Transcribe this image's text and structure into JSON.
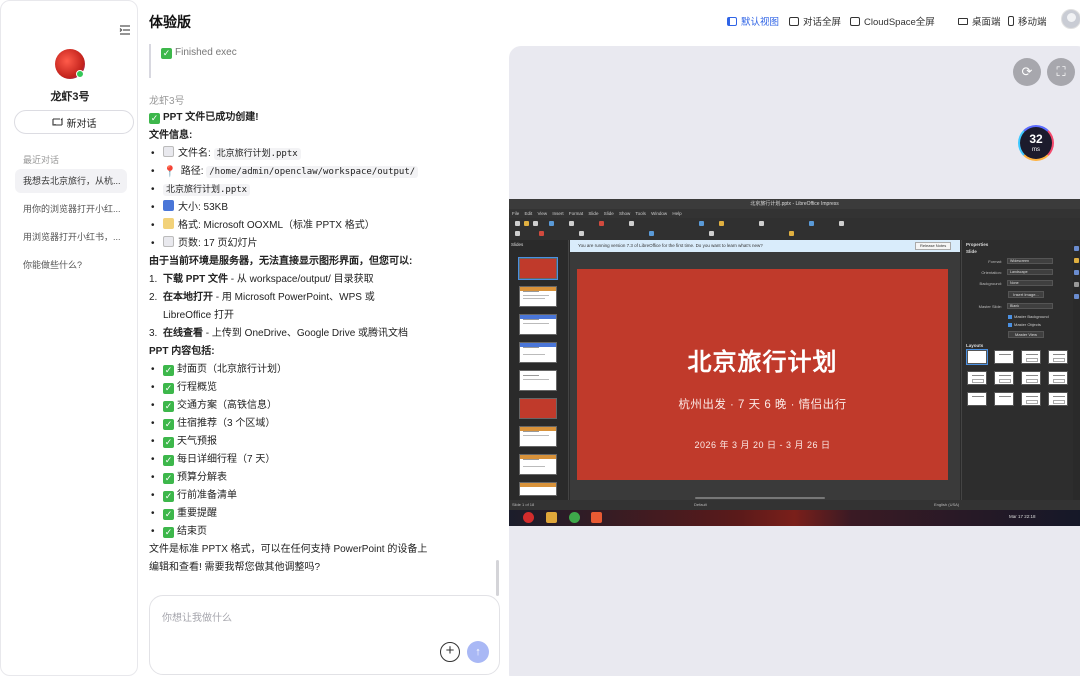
{
  "app": {
    "title": "体验版"
  },
  "sidebar": {
    "bot_name": "龙虾3号",
    "new_chat": "新对话",
    "recent_label": "最近对话",
    "conversations": [
      "我想去北京旅行，从杭...",
      "用你的浏览器打开小红...",
      "用浏览器打开小红书，...",
      "你能做些什么?"
    ]
  },
  "header": {
    "view_default": "默认视图",
    "view_chat_full": "对话全屏",
    "view_cloudspace_full": "CloudSpace全屏",
    "desktop": "桌面端",
    "mobile": "移动端",
    "accent": "#2f64e6"
  },
  "chat": {
    "exec_status": "Finished exec",
    "sender": "龙虾3号",
    "headline": "PPT 文件已成功创建!",
    "file_info_title": "文件信息:",
    "file_name_label": "文件名:",
    "file_name": "北京旅行计划.pptx",
    "path_label": "路径:",
    "path_part1": "/home/admin/openclaw/workspace/output/",
    "path_part2": "北京旅行计划.pptx",
    "size": "大小: 53KB",
    "format": "格式: Microsoft OOXML（标准 PPTX 格式）",
    "pages": "页数: 17 页幻灯片",
    "server_note": "由于当前环境是服务器，无法直接显示图形界面，但您可以:",
    "options": [
      {
        "num": "1.",
        "bold": "下载 PPT 文件",
        "rest": " - 从 workspace/output/ 目录获取"
      },
      {
        "num": "2.",
        "bold": "在本地打开",
        "rest": " - 用 Microsoft PowerPoint、WPS 或",
        "cont": "LibreOffice 打开"
      },
      {
        "num": "3.",
        "bold": "在线查看",
        "rest": " - 上传到 OneDrive、Google Drive 或腾讯文档"
      }
    ],
    "contents_title": "PPT 内容包括:",
    "contents": [
      "封面页（北京旅行计划）",
      "行程概览",
      "交通方案（高铁信息）",
      "住宿推荐（3 个区域）",
      "天气预报",
      "每日详细行程（7 天）",
      "预算分解表",
      "行前准备清单",
      "重要提醒",
      "结束页"
    ],
    "closing_line1": "文件是标准 PPTX 格式，可以在任何支持 PowerPoint 的设备上",
    "closing_line2": "编辑和查看! 需要我帮您做其他调整吗?"
  },
  "input": {
    "placeholder": "你想让我做什么"
  },
  "panel": {
    "latency_value": "32",
    "latency_unit": "ms"
  },
  "desktop_screen": {
    "window_title": "北京旅行计划.pptx - LibreOffice Impress",
    "menu": "File Edit View Insert Format Slide Slide Show Tools Window Help",
    "slides_label": "Slides",
    "info_text": "You are running version 7.3 of LibreOffice for the first time. Do you want to learn what's new?",
    "info_button": "Release Notes",
    "slide_title": "北京旅行计划",
    "slide_subtitle": "杭州出发 · 7 天 6 晚 · 情侣出行",
    "slide_date": "2026 年 3 月 20 日 - 3 月 26 日",
    "slide_color": "#c03a2b",
    "properties_title": "Properties",
    "slide_section": "Slide",
    "format_label": "Format:",
    "format_value": "Widescreen",
    "orientation_label": "Orientation:",
    "orientation_value": "Landscape",
    "background_label": "Background:",
    "background_value": "None",
    "insert_image": "Insert Image...",
    "master_label": "Master Slide:",
    "master_value": "Blank",
    "master_bg": "Master Background",
    "master_obj": "Master Objects",
    "master_view": "Master View",
    "layouts_label": "Layouts",
    "status_left": "Slide 1 of 18",
    "status_mid": "Default",
    "status_right": "English (USA)",
    "clock": "Mar 17 22:18"
  }
}
